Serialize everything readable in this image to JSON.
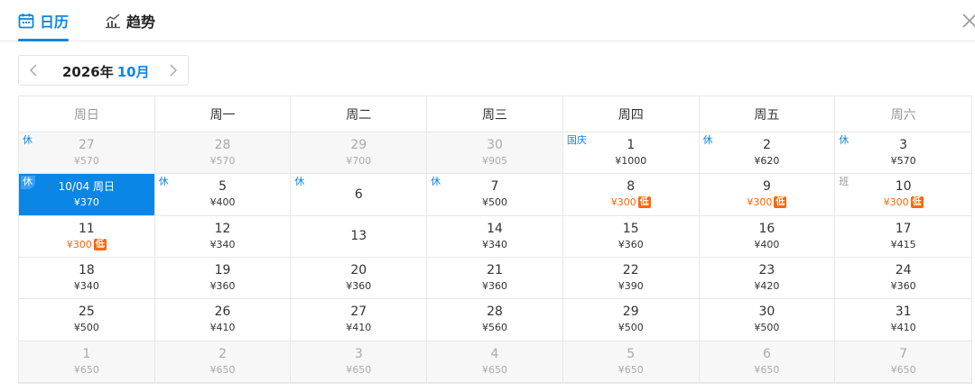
{
  "tabs": [
    {
      "label": "日历",
      "icon": "calendar-icon",
      "active": true
    },
    {
      "label": "趋势",
      "icon": "trend-chart-icon",
      "active": false
    }
  ],
  "colors": {
    "accent": "#0a86e6",
    "low_price": "#ff6600"
  },
  "month_nav": {
    "year": "2026年",
    "month": "10月"
  },
  "weekdays": [
    "周日",
    "周一",
    "周二",
    "周三",
    "周四",
    "周五",
    "周六"
  ],
  "low_label": "低",
  "cells": [
    {
      "day": "27",
      "price": "¥570",
      "tag": "休",
      "other": true
    },
    {
      "day": "28",
      "price": "¥570",
      "other": true
    },
    {
      "day": "29",
      "price": "¥700",
      "other": true
    },
    {
      "day": "30",
      "price": "¥905",
      "other": true
    },
    {
      "day": "1",
      "price": "¥1000",
      "tag": "国庆"
    },
    {
      "day": "2",
      "price": "¥620",
      "tag": "休"
    },
    {
      "day": "3",
      "price": "¥570",
      "tag": "休"
    },
    {
      "day": "10/04 周日",
      "price": "¥370",
      "tag": "休",
      "selected": true
    },
    {
      "day": "5",
      "price": "¥400",
      "tag": "休"
    },
    {
      "day": "6",
      "price": "",
      "tag": "休"
    },
    {
      "day": "7",
      "price": "¥500",
      "tag": "休"
    },
    {
      "day": "8",
      "price": "¥300",
      "low": true
    },
    {
      "day": "9",
      "price": "¥300",
      "low": true
    },
    {
      "day": "10",
      "price": "¥300",
      "low": true,
      "tag": "班",
      "work": true
    },
    {
      "day": "11",
      "price": "¥300",
      "low": true
    },
    {
      "day": "12",
      "price": "¥340"
    },
    {
      "day": "13",
      "price": ""
    },
    {
      "day": "14",
      "price": "¥340"
    },
    {
      "day": "15",
      "price": "¥360"
    },
    {
      "day": "16",
      "price": "¥400"
    },
    {
      "day": "17",
      "price": "¥415"
    },
    {
      "day": "18",
      "price": "¥340"
    },
    {
      "day": "19",
      "price": "¥360"
    },
    {
      "day": "20",
      "price": "¥360"
    },
    {
      "day": "21",
      "price": "¥360"
    },
    {
      "day": "22",
      "price": "¥390"
    },
    {
      "day": "23",
      "price": "¥420"
    },
    {
      "day": "24",
      "price": "¥360"
    },
    {
      "day": "25",
      "price": "¥500"
    },
    {
      "day": "26",
      "price": "¥410"
    },
    {
      "day": "27",
      "price": "¥410"
    },
    {
      "day": "28",
      "price": "¥560"
    },
    {
      "day": "29",
      "price": "¥500"
    },
    {
      "day": "30",
      "price": "¥500"
    },
    {
      "day": "31",
      "price": "¥410"
    },
    {
      "day": "1",
      "price": "¥650",
      "other": true
    },
    {
      "day": "2",
      "price": "¥650",
      "other": true
    },
    {
      "day": "3",
      "price": "¥650",
      "other": true
    },
    {
      "day": "4",
      "price": "¥650",
      "other": true
    },
    {
      "day": "5",
      "price": "¥650",
      "other": true
    },
    {
      "day": "6",
      "price": "¥650",
      "other": true
    },
    {
      "day": "7",
      "price": "¥650",
      "other": true
    }
  ]
}
